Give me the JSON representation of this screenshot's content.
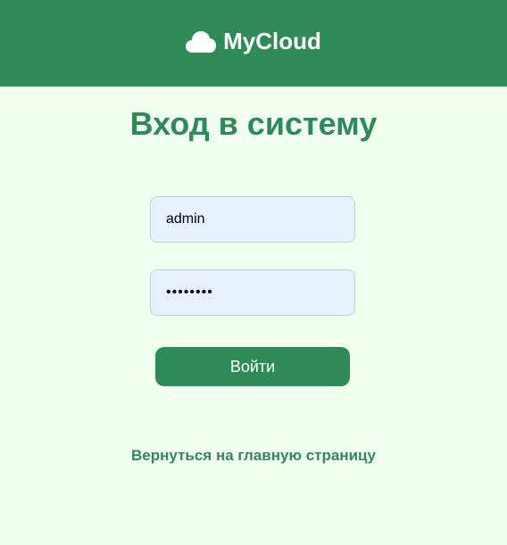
{
  "header": {
    "brand": "MyCloud",
    "icon": "cloud-icon",
    "background_color": "#2e8b57"
  },
  "login": {
    "title": "Вход в систему",
    "username_value": "admin",
    "password_value": "12345678",
    "submit_label": "Войти"
  },
  "footer": {
    "back_link": "Вернуться на главную страницу"
  },
  "colors": {
    "accent": "#2e8b57",
    "page_background": "#f0fff0",
    "input_background": "#e8f0fe"
  }
}
